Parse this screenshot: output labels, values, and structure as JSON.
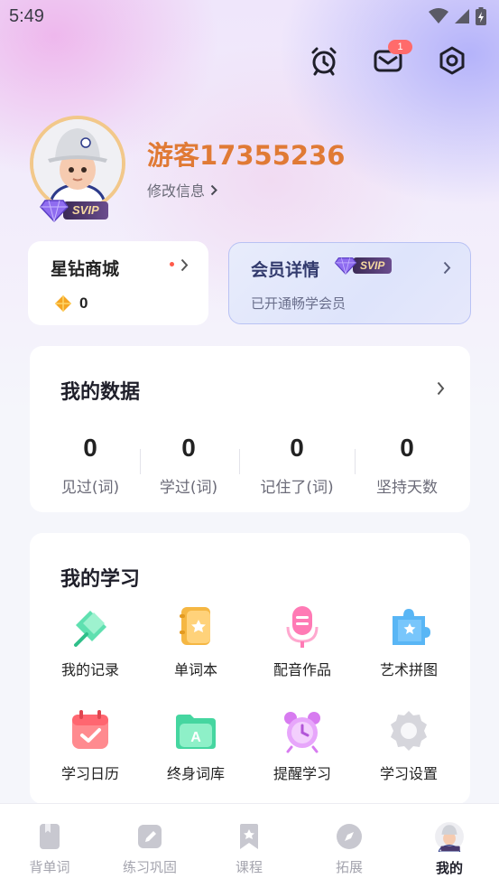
{
  "status_bar": {
    "time": "5:49"
  },
  "header": {
    "mail_badge": "1"
  },
  "profile": {
    "username": "游客17355236",
    "edit_label": "修改信息",
    "vip_badge": "SVIP"
  },
  "store": {
    "title": "星钻商城",
    "diamond_count": "0"
  },
  "vip": {
    "title": "会员详情",
    "badge": "SVIP",
    "subtitle": "已开通畅学会员"
  },
  "my_data": {
    "title": "我的数据",
    "stats": [
      {
        "value": "0",
        "label": "见过(词)"
      },
      {
        "value": "0",
        "label": "学过(词)"
      },
      {
        "value": "0",
        "label": "记住了(词)"
      },
      {
        "value": "0",
        "label": "坚持天数"
      }
    ]
  },
  "my_study": {
    "title": "我的学习",
    "items": [
      {
        "label": "我的记录",
        "icon": "pin-icon"
      },
      {
        "label": "单词本",
        "icon": "notebook-icon"
      },
      {
        "label": "配音作品",
        "icon": "microphone-icon"
      },
      {
        "label": "艺术拼图",
        "icon": "puzzle-icon"
      },
      {
        "label": "学习日历",
        "icon": "calendar-icon"
      },
      {
        "label": "终身词库",
        "icon": "folder-icon"
      },
      {
        "label": "提醒学习",
        "icon": "alarm-clock-icon"
      },
      {
        "label": "学习设置",
        "icon": "gear-icon"
      }
    ]
  },
  "bottom_nav": {
    "items": [
      {
        "label": "背单词",
        "icon": "book-icon"
      },
      {
        "label": "练习巩固",
        "icon": "pencil-icon"
      },
      {
        "label": "课程",
        "icon": "bookmark-icon"
      },
      {
        "label": "拓展",
        "icon": "compass-icon"
      },
      {
        "label": "我的",
        "icon": "avatar-icon",
        "active": true
      }
    ]
  },
  "colors": {
    "accent_orange": "#e07a35",
    "badge_red": "#ff6b6b",
    "vip_border": "#b9c2f4"
  }
}
